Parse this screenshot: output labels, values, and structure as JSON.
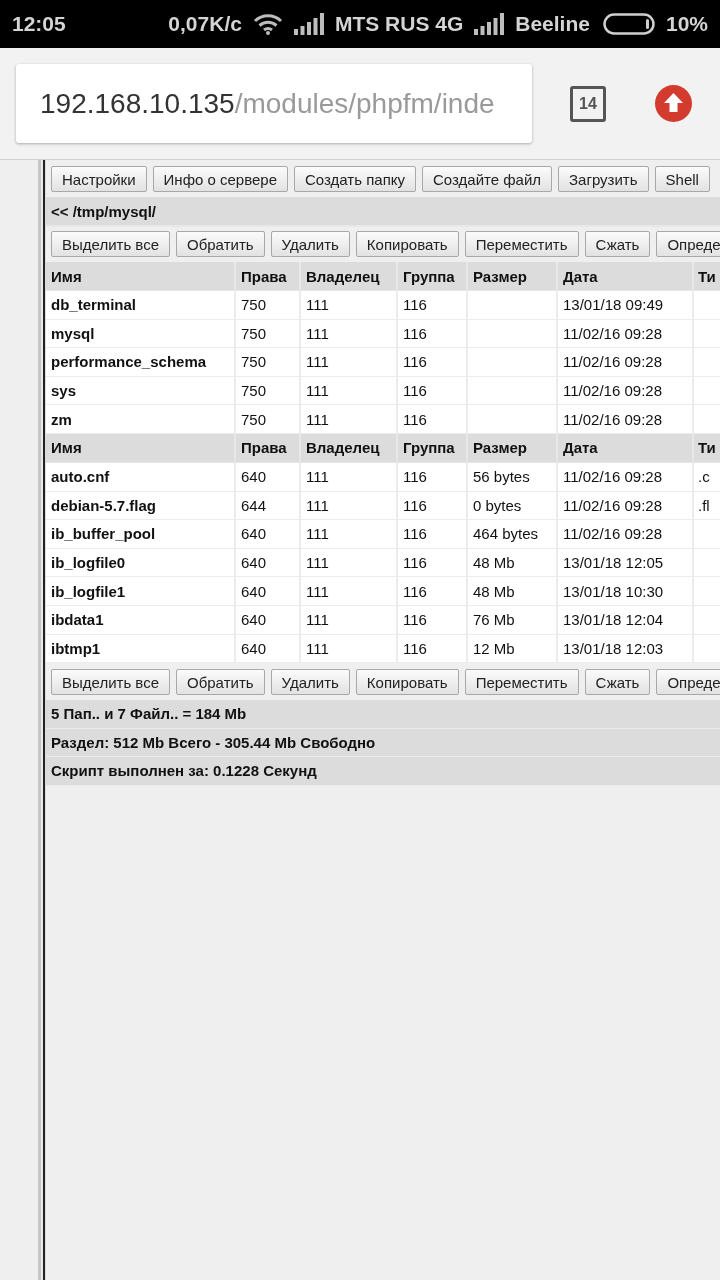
{
  "status_bar": {
    "time": "12:05",
    "speed": "0,07K/c",
    "carriers": [
      {
        "name": "MTS RUS 4G"
      },
      {
        "name": "Beeline"
      }
    ],
    "battery": "10%"
  },
  "browser": {
    "url_host": "192.168.10.135",
    "url_path": "/modules/phpfm/inde",
    "tab_count": "14"
  },
  "toolbar": [
    "Настройки",
    "Инфо о сервере",
    "Создать папку",
    "Создайте файл",
    "Загрузить",
    "Shell"
  ],
  "path": "<< /tmp/mysql/",
  "actions_top": [
    "Выделить все",
    "Обратить",
    "Удалить",
    "Копировать",
    "Переместить",
    "Сжать",
    "Опреде"
  ],
  "table": {
    "sections": [
      {
        "columns": [
          "Имя",
          "Права",
          "Владелец",
          "Группа",
          "Размер",
          "Дата",
          "Ти"
        ],
        "rows": [
          {
            "name": "db_terminal",
            "permissions": "750",
            "owner": "111",
            "group": "116",
            "date": "13/01/18 09:49"
          },
          {
            "name": "mysql",
            "permissions": "750",
            "owner": "111",
            "group": "116",
            "date": "11/02/16 09:28"
          },
          {
            "name": "performance_schema",
            "permissions": "750",
            "owner": "111",
            "group": "116",
            "date": "11/02/16 09:28"
          },
          {
            "name": "sys",
            "permissions": "750",
            "owner": "111",
            "group": "116",
            "date": "11/02/16 09:28"
          },
          {
            "name": "zm",
            "permissions": "750",
            "owner": "111",
            "group": "116",
            "date": "11/02/16 09:28"
          }
        ]
      },
      {
        "columns": [
          "Имя",
          "Права",
          "Владелец",
          "Группа",
          "Размер",
          "Дата",
          "Ти"
        ],
        "rows": [
          {
            "name": "auto.cnf",
            "permissions": "640",
            "owner": "111",
            "group": "116",
            "size": "56 bytes",
            "date": "11/02/16 09:28",
            "column_7": ".c"
          },
          {
            "name": "debian-5.7.flag",
            "permissions": "644",
            "owner": "111",
            "group": "116",
            "size": "0 bytes",
            "date": "11/02/16 09:28",
            "column_7": ".fl"
          },
          {
            "name": "ib_buffer_pool",
            "permissions": "640",
            "owner": "111",
            "group": "116",
            "size": "464 bytes",
            "date": "11/02/16 09:28"
          },
          {
            "name": "ib_logfile0",
            "permissions": "640",
            "owner": "111",
            "group": "116",
            "size": "48 Mb",
            "date": "13/01/18 12:05"
          },
          {
            "name": "ib_logfile1",
            "permissions": "640",
            "owner": "111",
            "group": "116",
            "size": "48 Mb",
            "date": "13/01/18 10:30"
          },
          {
            "name": "ibdata1",
            "permissions": "640",
            "owner": "111",
            "group": "116",
            "size": "76 Mb",
            "date": "13/01/18 12:04"
          },
          {
            "name": "ibtmp1",
            "permissions": "640",
            "owner": "111",
            "group": "116",
            "size": "12 Mb",
            "date": "13/01/18 12:03"
          }
        ]
      }
    ]
  },
  "actions_bottom": [
    "Выделить все",
    "Обратить",
    "Удалить",
    "Копировать",
    "Переместить",
    "Сжать",
    "Опреде"
  ],
  "summary": [
    "5 Пап.. и 7 Файл.. = 184 Mb",
    "Раздел: 512 Mb Всего - 305.44 Mb Свободно",
    "Скрипт выполнен за: 0.1228 Секунд"
  ]
}
